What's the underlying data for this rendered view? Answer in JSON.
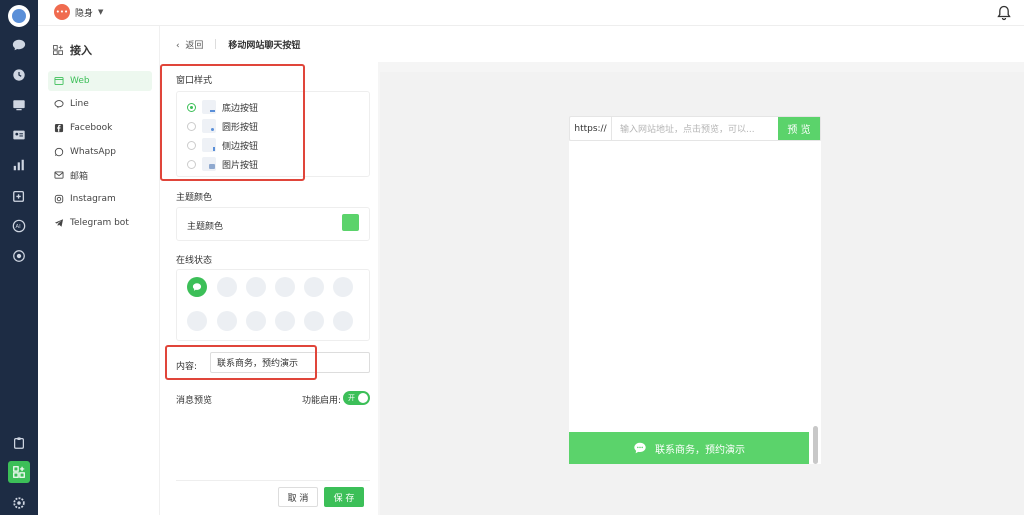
{
  "topbar": {
    "status_label": "隐身",
    "status_icon": "chat-bubble-icon",
    "bell_icon": "bell-icon"
  },
  "sidebar": {
    "title": "接入",
    "items": [
      {
        "label": "Web",
        "icon": "web-window-icon",
        "selected": true
      },
      {
        "label": "Line",
        "icon": "line-icon"
      },
      {
        "label": "Facebook",
        "icon": "facebook-icon"
      },
      {
        "label": "WhatsApp",
        "icon": "whatsapp-icon"
      },
      {
        "label": "邮箱",
        "icon": "mail-icon"
      },
      {
        "label": "Instagram",
        "icon": "instagram-icon"
      },
      {
        "label": "Telegram bot",
        "icon": "telegram-icon"
      }
    ]
  },
  "breadcrumb": {
    "back_label": "返回",
    "title": "移动网站聊天按钮"
  },
  "config": {
    "window_style": {
      "label": "窗口样式",
      "options": [
        {
          "label": "底边按钮",
          "checked": true
        },
        {
          "label": "圆形按钮",
          "checked": false
        },
        {
          "label": "侧边按钮",
          "checked": false
        },
        {
          "label": "图片按钮",
          "checked": false
        }
      ]
    },
    "theme": {
      "section_label": "主题颜色",
      "row_label": "主题颜色",
      "color": "#5bd36b"
    },
    "online_status": {
      "label": "在线状态"
    },
    "content": {
      "label": "内容:",
      "value": "联系商务，预约演示"
    },
    "message_preview": {
      "label": "消息预览",
      "enable_label": "功能启用:",
      "toggle_text": "开"
    },
    "cancel_label": "取 消",
    "save_label": "保 存"
  },
  "preview": {
    "url_prefix": "https://",
    "url_placeholder": "输入网站地址，点击预览，可以...",
    "preview_button": "预 览",
    "chat_button_text": "联系商务，预约演示"
  },
  "colors": {
    "accent": "#3cbf58",
    "rail": "#1d2c44",
    "annotation": "#e0453a"
  }
}
